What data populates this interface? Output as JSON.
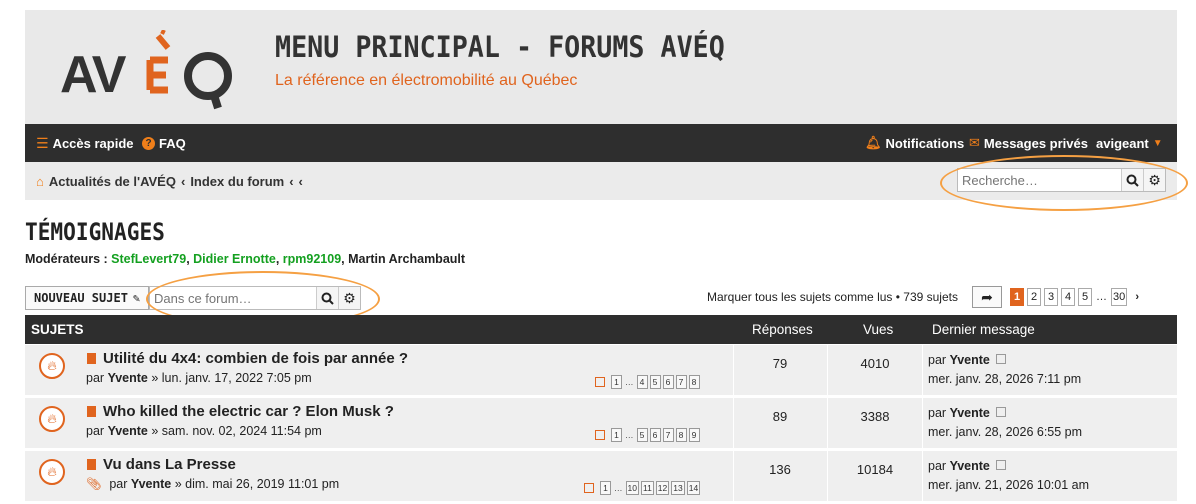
{
  "header": {
    "logo_text": "AVÉQ",
    "title": "MENU PRINCIPAL - FORUMS AVÉQ",
    "subtitle": "La référence en électromobilité au Québec"
  },
  "navbar": {
    "quick_access": "Accès rapide",
    "faq": "FAQ",
    "notifications": "Notifications",
    "private_messages": "Messages privés",
    "username": "avigeant"
  },
  "breadcrumb": {
    "home": "Actualités de l'AVÉQ",
    "sep": "‹",
    "index": "Index du forum"
  },
  "search": {
    "placeholder": "Recherche…"
  },
  "forum": {
    "title": "TÉMOIGNAGES",
    "moderators_label": "Modérateurs :",
    "moderators": [
      "StefLevert79",
      "Didier Ernotte",
      "rpm92109",
      "Martin Archambault"
    ],
    "new_topic": "NOUVEAU SUJET",
    "forum_search_placeholder": "Dans ce forum…",
    "mark_read_text": "Marquer tous les sujets comme lus • 739 sujets",
    "pages": [
      "1",
      "2",
      "3",
      "4",
      "5",
      "…",
      "30"
    ],
    "current_page": "1"
  },
  "table": {
    "headers": {
      "topics": "SUJETS",
      "replies": "Réponses",
      "views": "Vues",
      "last_post": "Dernier message"
    },
    "rows": [
      {
        "title": "Utilité du 4x4: combien de fois par année ?",
        "by": "par",
        "author": "Yvente",
        "date": "» lun. janv. 17, 2022 7:05 pm",
        "pages": [
          "1",
          "…",
          "4",
          "5",
          "6",
          "7",
          "8"
        ],
        "replies": "79",
        "views": "4010",
        "last_by": "par",
        "last_author": "Yvente",
        "last_date": "mer. janv. 28, 2026 7:11 pm"
      },
      {
        "title": "Who killed the electric car ? Elon Musk ?",
        "by": "par",
        "author": "Yvente",
        "date": "» sam. nov. 02, 2024 11:54 pm",
        "pages": [
          "1",
          "…",
          "5",
          "6",
          "7",
          "8",
          "9"
        ],
        "replies": "89",
        "views": "3388",
        "last_by": "par",
        "last_author": "Yvente",
        "last_date": "mer. janv. 28, 2026 6:55 pm"
      },
      {
        "title": "Vu dans La Presse",
        "by": "par",
        "author": "Yvente",
        "date": "» dim. mai 26, 2019 11:01 pm",
        "pages": [
          "1",
          "…",
          "10",
          "11",
          "12",
          "13",
          "14"
        ],
        "replies": "136",
        "views": "10184",
        "last_by": "par",
        "last_author": "Yvente",
        "last_date": "mer. janv. 21, 2026 10:01 am"
      }
    ]
  },
  "colors": {
    "accent": "#e0641e",
    "dark_bar": "#2e2e2e",
    "moderator_green": "#14a020",
    "annotation_ring": "#f5a043"
  }
}
